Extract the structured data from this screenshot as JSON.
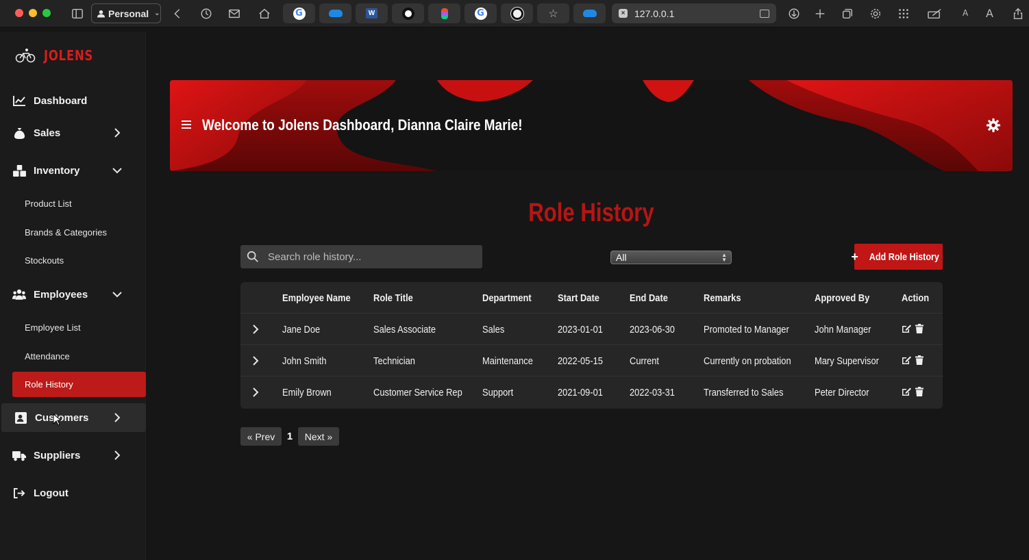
{
  "browser": {
    "profile_label": "Personal",
    "url": "127.0.0.1",
    "small_a": "A",
    "large_a": "A",
    "word_letter": "W"
  },
  "brand": {
    "name": "JOLENS"
  },
  "sidebar": {
    "items": [
      {
        "label": "Dashboard",
        "icon": "chart-line-icon"
      },
      {
        "label": "Sales",
        "icon": "money-bag-icon"
      },
      {
        "label": "Inventory",
        "icon": "boxes-icon"
      },
      {
        "label": "Employees",
        "icon": "users-icon"
      },
      {
        "label": "Customers",
        "icon": "address-card-icon"
      },
      {
        "label": "Suppliers",
        "icon": "truck-icon"
      },
      {
        "label": "Logout",
        "icon": "logout-icon"
      }
    ],
    "inventory_sub": [
      "Product List",
      "Brands & Categories",
      "Stockouts"
    ],
    "employees_sub": [
      "Employee List",
      "Attendance",
      "Role History"
    ]
  },
  "header": {
    "welcome": "Welcome to Jolens Dashboard, Dianna Claire Marie!"
  },
  "main": {
    "title": "Role History",
    "search_placeholder": "Search role history...",
    "filter_selected": "All",
    "add_button_label": "Add Role History",
    "columns": [
      "Employee Name",
      "Role Title",
      "Department",
      "Start Date",
      "End Date",
      "Remarks",
      "Approved By",
      "Action"
    ],
    "rows": [
      [
        "Jane Doe",
        "Sales Associate",
        "Sales",
        "2023-01-01",
        "2023-06-30",
        "Promoted to Manager",
        "John Manager"
      ],
      [
        "John Smith",
        "Technician",
        "Maintenance",
        "2022-05-15",
        "Current",
        "Currently on probation",
        "Mary Supervisor"
      ],
      [
        "Emily Brown",
        "Customer Service Rep",
        "Support",
        "2021-09-01",
        "2022-03-31",
        "Transferred to Sales",
        "Peter Director"
      ]
    ],
    "pagination": {
      "prev": "« Prev",
      "page": "1",
      "next": "Next »"
    }
  },
  "colors": {
    "accent": "#c01616",
    "title": "#b81414",
    "background": "#161616",
    "sidebar": "#1b1b1b"
  }
}
